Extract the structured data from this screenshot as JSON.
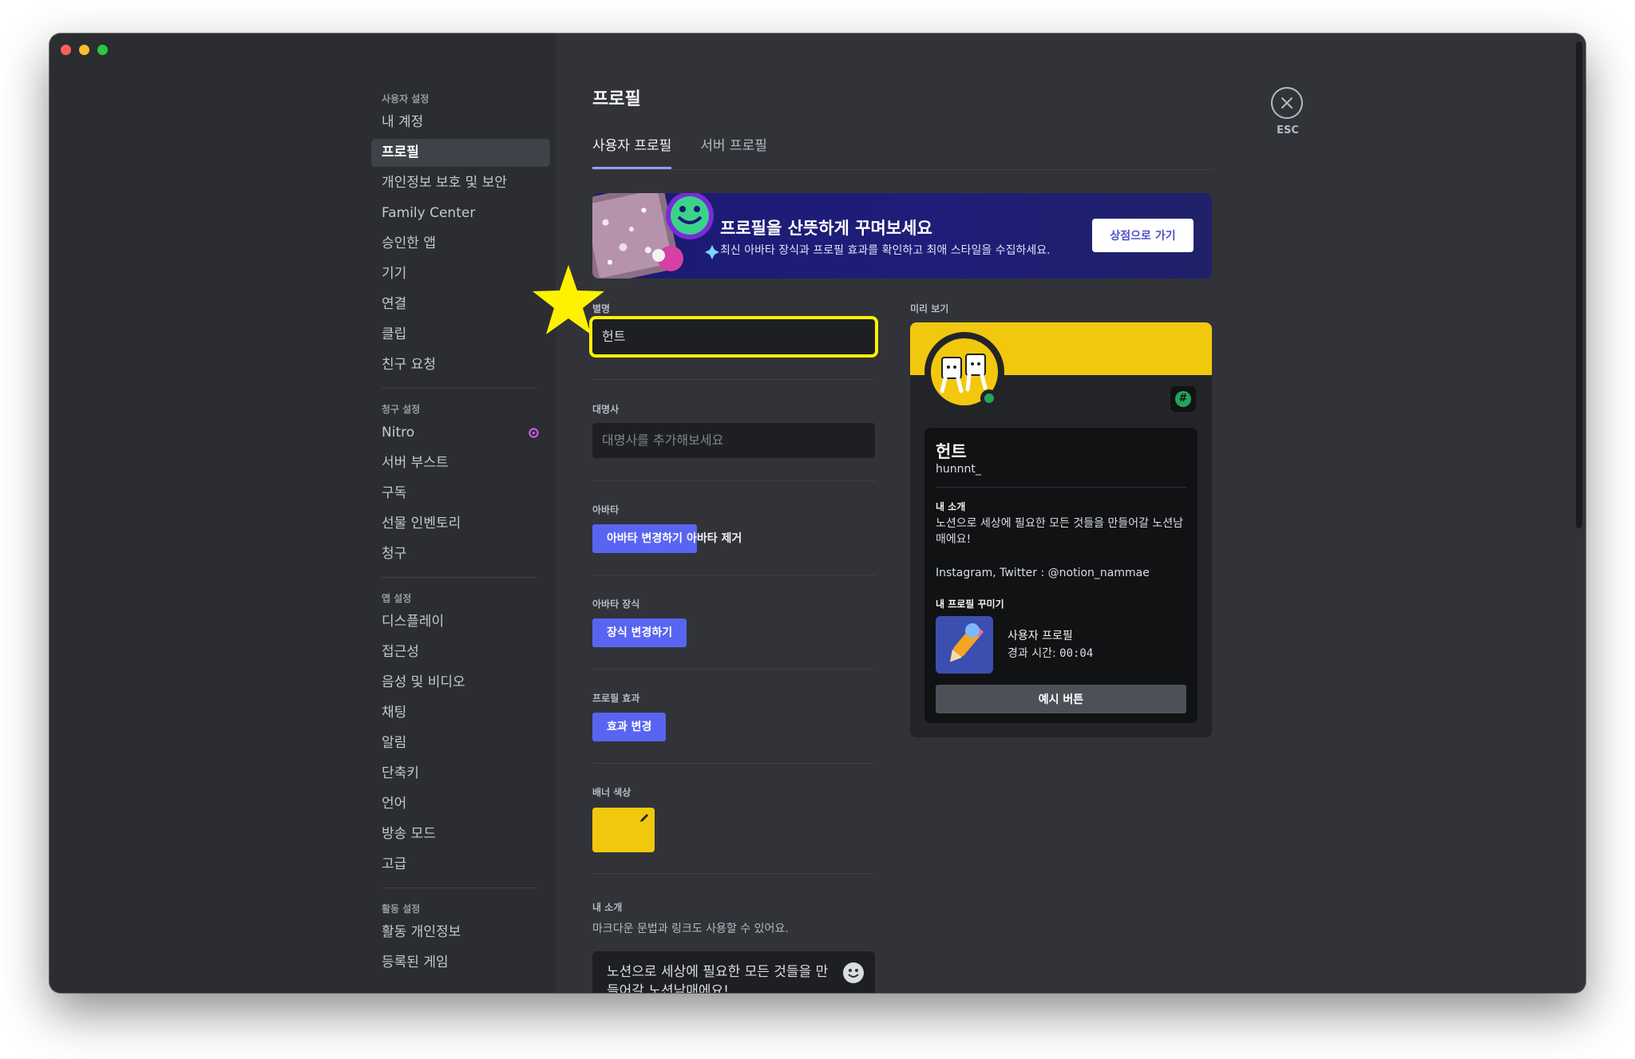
{
  "sidebar": {
    "sections": [
      {
        "header": "사용자 설정",
        "items": [
          {
            "label": "내 계정"
          },
          {
            "label": "프로필",
            "active": true
          },
          {
            "label": "개인정보 보호 및 보안"
          },
          {
            "label": "Family Center"
          },
          {
            "label": "승인한 앱"
          },
          {
            "label": "기기"
          },
          {
            "label": "연결"
          },
          {
            "label": "클립"
          },
          {
            "label": "친구 요청"
          }
        ]
      },
      {
        "header": "청구 설정",
        "items": [
          {
            "label": "Nitro",
            "icon": "nitro-icon"
          },
          {
            "label": "서버 부스트"
          },
          {
            "label": "구독"
          },
          {
            "label": "선물 인벤토리"
          },
          {
            "label": "청구"
          }
        ]
      },
      {
        "header": "앱 설정",
        "items": [
          {
            "label": "디스플레이"
          },
          {
            "label": "접근성"
          },
          {
            "label": "음성 및 비디오"
          },
          {
            "label": "채팅"
          },
          {
            "label": "알림"
          },
          {
            "label": "단축키"
          },
          {
            "label": "언어"
          },
          {
            "label": "방송 모드"
          },
          {
            "label": "고급"
          }
        ]
      },
      {
        "header": "활동 설정",
        "items": [
          {
            "label": "활동 개인정보"
          },
          {
            "label": "등록된 게임"
          }
        ]
      }
    ]
  },
  "page": {
    "title": "프로필",
    "tabs": [
      "사용자 프로필",
      "서버 프로필"
    ],
    "esc_label": "ESC"
  },
  "banner": {
    "title": "프로필을 산뜻하게 꾸며보세요",
    "description": "최신 아바타 장식과 프로필 효과를 확인하고 최애 스타일을 수집하세요.",
    "button": "상점으로 가기"
  },
  "form": {
    "nickname_label": "별명",
    "nickname_value": "헌트",
    "pronouns_label": "대명사",
    "pronouns_placeholder": "대명사를 추가해보세요",
    "avatar_label": "아바타",
    "avatar_change": "아바타 변경하기",
    "avatar_remove": "아바타 제거",
    "decoration_label": "아바타 장식",
    "decoration_change": "장식 변경하기",
    "effect_label": "프로필 효과",
    "effect_change": "효과 변경",
    "banner_color_label": "배너 색상",
    "banner_color": "#f2c80f",
    "bio_label": "내 소개",
    "bio_hint": "마크다운 문법과 링크도 사용할 수 있어요.",
    "bio_value": "노션으로 세상에 필요한 모든 것들을 만들어갈 노션남매에요!"
  },
  "preview": {
    "label": "미리 보기",
    "display_name": "헌트",
    "username": "hunnnt_",
    "about_header": "내 소개",
    "about_line1": "노션으로 세상에 필요한 모든 것들을 만들어갈 노션남매에요!",
    "about_line2": "Instagram, Twitter : @notion_nammae",
    "customize_header": "내 프로필 꾸미기",
    "activity_title": "사용자 프로필",
    "activity_time_label": "경과 시간:",
    "activity_time": "00:04",
    "example_button": "예시 버튼"
  },
  "colors": {
    "accent": "#5865f2",
    "highlight": "#fff200",
    "banner_yellow": "#f2c80f",
    "status_online": "#23a55a"
  }
}
